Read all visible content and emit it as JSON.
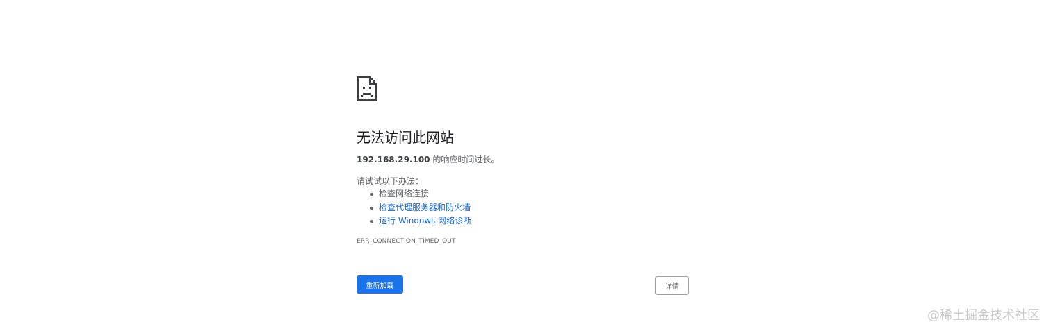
{
  "error_page": {
    "icon": "sad-page-icon",
    "title": "无法访问此网站",
    "summary_host": "192.168.29.100",
    "summary_text": " 的响应时间过长。",
    "suggestions_heading": "请试试以下办法：",
    "suggestions": [
      {
        "label": "检查网络连接",
        "is_link": false
      },
      {
        "label": "检查代理服务器和防火墙",
        "is_link": true
      },
      {
        "label": "运行 Windows 网络诊断",
        "is_link": true
      }
    ],
    "error_code": "ERR_CONNECTION_TIMED_OUT",
    "reload_label": "重新加载",
    "details_label": "详情"
  },
  "colors": {
    "primary_button": "#1a73e8",
    "link": "#1967d2",
    "text_secondary": "#5f6368"
  },
  "watermark": "@稀土掘金技术社区"
}
